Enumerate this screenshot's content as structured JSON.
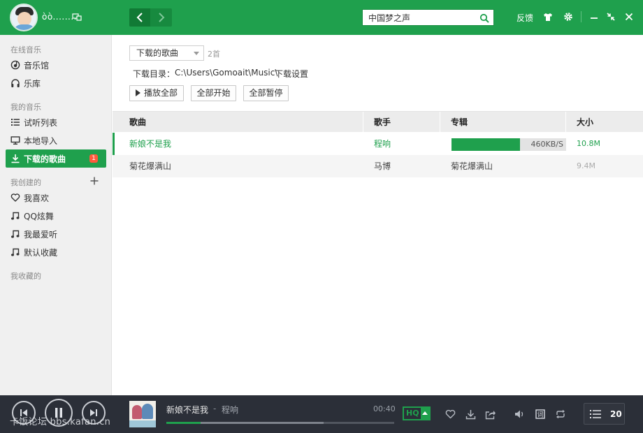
{
  "app": {
    "username": "òò........",
    "nav_back": "back",
    "nav_forward": "forward",
    "feedback_label": "反馈"
  },
  "search": {
    "value": "中国梦之声",
    "placeholder": ""
  },
  "sidebar": {
    "sections": [
      {
        "label": "在线音乐"
      },
      {
        "label": "我的音乐"
      },
      {
        "label": "我创建的"
      },
      {
        "label": "我收藏的"
      }
    ],
    "items": [
      {
        "label": "音乐馆",
        "icon": "music-hall-icon"
      },
      {
        "label": "乐库",
        "icon": "headphones-icon"
      },
      {
        "label": "试听列表",
        "icon": "list-icon"
      },
      {
        "label": "本地导入",
        "icon": "monitor-icon"
      },
      {
        "label": "下载的歌曲",
        "icon": "download-icon",
        "active": true,
        "badge": "1"
      },
      {
        "label": "我喜欢",
        "icon": "heart-icon"
      },
      {
        "label": "QQ炫舞",
        "icon": "music-note-icon"
      },
      {
        "label": "我最爱听",
        "icon": "music-note-icon"
      },
      {
        "label": "默认收藏",
        "icon": "music-note-icon"
      }
    ]
  },
  "main": {
    "dropdown_value": "下载的歌曲",
    "song_count": "2首",
    "download_dir_label": "下载目录：",
    "download_dir_path": "C:\\Users\\Gomoait\\Music\\",
    "download_settings_link": "下载设置",
    "buttons": {
      "play_all": "播放全部",
      "start_all": "全部开始",
      "pause_all": "全部暂停"
    },
    "table": {
      "columns": [
        "歌曲",
        "歌手",
        "专辑",
        "大小"
      ],
      "rows": [
        {
          "song": "新娘不是我",
          "artist": "程响",
          "album": "",
          "progress": 0.6,
          "speed": "460KB/S",
          "size": "10.8M",
          "state": "downloading"
        },
        {
          "song": "菊花爆满山",
          "artist": "马博",
          "album": "菊花爆满山",
          "size": "9.4M",
          "state": "done"
        }
      ]
    }
  },
  "player": {
    "title": "新娘不是我",
    "separator": "-",
    "artist": "程响",
    "time": "00:40",
    "quality": "HQ",
    "progress_played": 0.15,
    "progress_buffered": 0.69,
    "playlist_count": "20",
    "watermark": "卡饭论坛 bbs.kafan.cn"
  },
  "colors": {
    "brand_green": "#1fa04d",
    "player_bg": "#2b2f38",
    "badge_red": "#ff5a3c"
  }
}
